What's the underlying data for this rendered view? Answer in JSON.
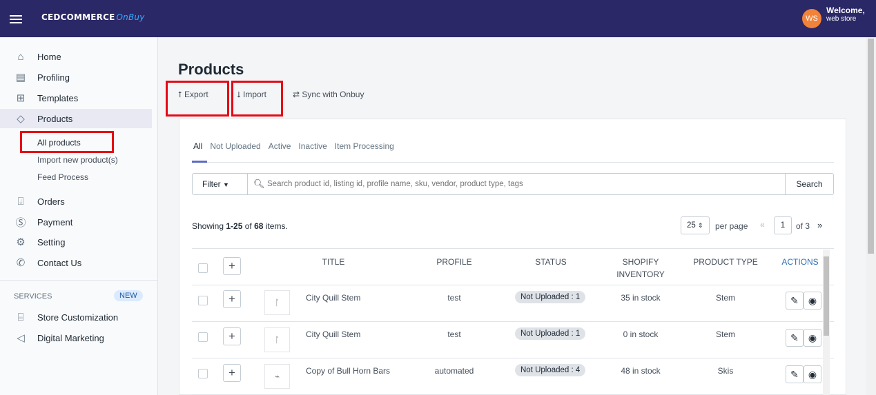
{
  "topbar": {
    "logo_main": "CEDCOMMERCE",
    "logo_sub": "OnBuy",
    "avatar_initials": "WS",
    "welcome": "Welcome,",
    "store": "web store"
  },
  "sidebar": {
    "items": [
      {
        "label": "Home",
        "icon": "home-icon"
      },
      {
        "label": "Profiling",
        "icon": "profiling-icon"
      },
      {
        "label": "Templates",
        "icon": "templates-icon"
      },
      {
        "label": "Products",
        "icon": "tag-icon"
      },
      {
        "label": "Orders",
        "icon": "orders-icon"
      },
      {
        "label": "Payment",
        "icon": "dollar-icon"
      },
      {
        "label": "Setting",
        "icon": "gear-icon"
      },
      {
        "label": "Contact Us",
        "icon": "phone-icon"
      }
    ],
    "sub_items": [
      "All products",
      "Import new product(s)",
      "Feed Process"
    ],
    "services_label": "SERVICES",
    "new_badge": "NEW",
    "services": [
      {
        "label": "Store Customization",
        "icon": "store-icon"
      },
      {
        "label": "Digital Marketing",
        "icon": "megaphone-icon"
      }
    ]
  },
  "main": {
    "title": "Products",
    "export_label": "Export",
    "import_label": "Import",
    "sync_label": "Sync with Onbuy",
    "tabs": [
      "All",
      "Not Uploaded",
      "Active",
      "Inactive",
      "Item Processing"
    ],
    "filter_label": "Filter",
    "search_placeholder": "Search product id, listing id, profile name, sku, vendor, product type, tags",
    "search_button": "Search",
    "showing_prefix": "Showing ",
    "showing_range": "1-25",
    "showing_of": " of ",
    "showing_total": "68",
    "showing_suffix": " items.",
    "per_page_value": "25",
    "per_page_label": "per page",
    "current_page": "1",
    "of_pages": "of 3",
    "columns": {
      "title": "TITLE",
      "profile": "PROFILE",
      "status": "STATUS",
      "inventory_1": "SHOPIFY",
      "inventory_2": "INVENTORY",
      "product_type": "PRODUCT TYPE",
      "actions": "ACTIONS"
    },
    "rows": [
      {
        "title": "City Quill Stem",
        "profile": "test",
        "status": "Not Uploaded : 1",
        "inventory": "35 in stock",
        "type": "Stem"
      },
      {
        "title": "City Quill Stem",
        "profile": "test",
        "status": "Not Uploaded : 1",
        "inventory": "0 in stock",
        "type": "Stem"
      },
      {
        "title": "Copy of Bull Horn Bars",
        "profile": "automated",
        "status": "Not Uploaded : 4",
        "inventory": "48 in stock",
        "type": "Skis"
      }
    ]
  },
  "colors": {
    "topbar": "#2a2866",
    "accent": "#5c6ac4",
    "highlight": "#e50914"
  }
}
